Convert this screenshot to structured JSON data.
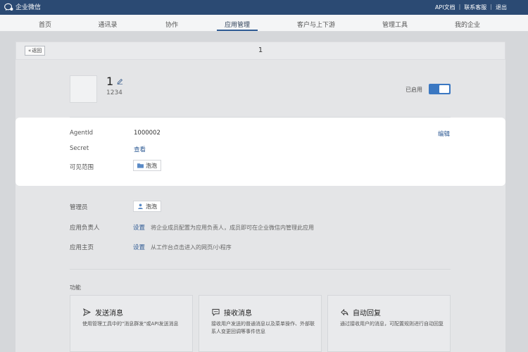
{
  "topbar": {
    "brand": "企业微信",
    "links": [
      "API文档",
      "联系客服",
      "退出"
    ],
    "bg_color": "#2b4a73"
  },
  "nav": {
    "items": [
      "首页",
      "通讯录",
      "协作",
      "应用管理",
      "客户与上下游",
      "管理工具",
      "我的企业"
    ],
    "active": "应用管理"
  },
  "header": {
    "back_label": "返回",
    "title": "1"
  },
  "app": {
    "name": "1",
    "id": "1234",
    "status_label": "已启用",
    "enabled": true
  },
  "info": {
    "agentid_label": "AgentId",
    "agentid_value": "1000002",
    "edit_label": "编辑",
    "secret_label": "Secret",
    "secret_link": "查看",
    "visible_label": "可见范围",
    "visible_value": "泡泡"
  },
  "admin": {
    "admin_label": "管理员",
    "admin_value": "泡泡",
    "owner_label": "应用负责人",
    "owner_link": "设置",
    "owner_desc": "将企业成员配置为应用负责人，成员即可在企业微信内管理此应用",
    "home_label": "应用主页",
    "home_link": "设置",
    "home_desc": "从工作台点击进入的网页/小程序"
  },
  "features": {
    "title": "功能",
    "cards": [
      {
        "icon": "send-icon",
        "title": "发送消息",
        "desc": "使用管理工具中的\"消息群发\"或API发送消息"
      },
      {
        "icon": "message-icon",
        "title": "接收消息",
        "desc": "接收用户发送的普通消息以及菜单操作、外部联系人变更回调等事件信息"
      },
      {
        "icon": "reply-icon",
        "title": "自动回复",
        "desc": "通过接收用户的消息，可配置规则进行自动回复"
      }
    ]
  },
  "colors": {
    "accent": "#3b78c2",
    "link": "#2f5b94"
  }
}
